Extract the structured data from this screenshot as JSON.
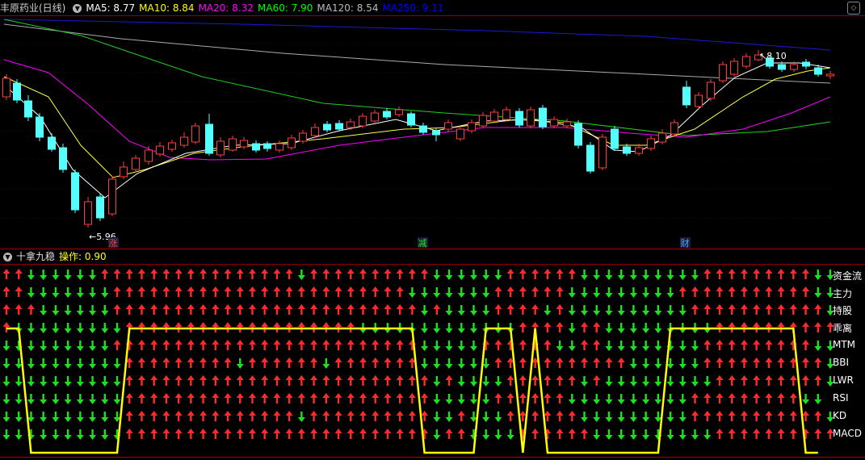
{
  "header": {
    "stock_title": "丰原药业(日线)",
    "ma": [
      {
        "label": "MA5: 8.77",
        "color": "#ffffff"
      },
      {
        "label": "MA10: 8.84",
        "color": "#ffff00"
      },
      {
        "label": "MA20: 8.32",
        "color": "#ff00ff"
      },
      {
        "label": "MA60: 7.90",
        "color": "#00ff00"
      },
      {
        "label": "MA120: 8.54",
        "color": "#bbbbbb"
      },
      {
        "label": "MA250: 9.11",
        "color": "#0000ff"
      }
    ]
  },
  "price_panel": {
    "high_label": "8.10",
    "low_label": "5.96",
    "event_markers": [
      {
        "text": "涨",
        "color": "#ff4040"
      },
      {
        "text": "减",
        "color": "#00ff00"
      },
      {
        "text": "财",
        "color": "#4aa8ff"
      }
    ]
  },
  "indicator_panel": {
    "name": "十拿九稳",
    "op_label": "操作: 0.90",
    "rows": [
      "资金流",
      "主力",
      "持股",
      "乖离",
      "MTM",
      "BBI",
      "LWR",
      "RSI",
      "KD",
      "MACD"
    ],
    "signal_line": [
      1,
      1,
      0,
      0,
      0,
      0,
      0,
      0,
      0,
      0,
      1,
      1,
      1,
      1,
      1,
      1,
      1,
      1,
      1,
      1,
      1,
      1,
      1,
      1,
      1,
      1,
      1,
      1,
      1,
      1,
      1,
      1,
      1,
      1,
      0,
      0,
      0,
      0,
      0,
      1,
      1,
      1,
      0,
      1,
      0,
      0,
      0,
      0,
      0,
      0,
      0,
      0,
      0,
      0,
      1,
      1,
      1,
      1,
      1,
      1,
      1,
      1,
      1,
      1,
      1,
      0,
      0
    ],
    "arrow_grid": [
      "UUDDDDDDUUUUUUUUUUUUUUUUDUUUUUUUUUUDDDDDDUUUUUUDDDDDDDDDDUUUUUUUUUDD",
      "UUDDDDDDDUUUUUUUUUUUUUUUUUUUUUUUUDDDDDDDUUUUUUDDDDDDDDDUUUUUUUUUUUDD",
      "UUUDDDDDDUUUUUUUUUUUUUUUUUUUUUUUUUDUDDDDUUUUDUDDDDDDDDDDUUUUUUUUUUUD",
      "UDDDDDDDDDUUUUUUUUUUUUUUUUUUUDDDDDDDDDDDDDUUUUDUUDDDDDDDDDUUUUUUUUUU",
      "DDDDDDDDDUUUUUUUUUUUUUUUUUUUUUUUUUDDDDDUUUUUUDDUUDDDDDDDDUUUUUUUUUDD",
      "DDDDDDDDDDUUUUUUUUUDUUUUUUDUUUUUUUDDDDDDUUUUUUUUUUUDDDDDDUUUUUUUUUUD",
      "DDDDDDDDDDUUUUUUUUUUUUUUUUUUUUUUUUUDUDDDDUUUUUUDUDDDDDDDDDUUUUUUUUUD",
      "DDDDDDDDDDUUUUUUUUUUUUUUUUUUUUUUUUUDDDDDUUUUUUDDDDDDDDDDUUUUUUUUUDD",
      "DDDDDDDDDDUUUUUUUUUUUUUUDUUUUUUUUUUDDUDDDUUUUUUDDDDDDDDDUUUUUUUUUUUD",
      "DDDDDDDDDDUUUUUUUUUUUUUUUUUUUUUUUUUDUUDDDDUUUUUUDDDDDDDDDDUUUUUUUUUU"
    ]
  }
}
